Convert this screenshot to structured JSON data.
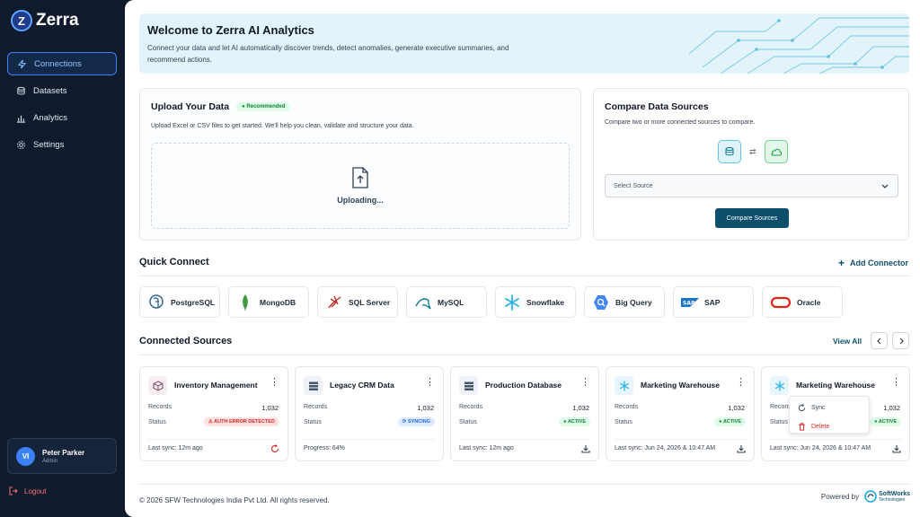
{
  "app": {
    "name": "Zerra",
    "logo_letter": "Z"
  },
  "sidebar": {
    "items": [
      {
        "label": "Connections",
        "icon": "bolt-icon",
        "active": true
      },
      {
        "label": "Datasets",
        "icon": "database-icon"
      },
      {
        "label": "Analytics",
        "icon": "chart-icon"
      },
      {
        "label": "Settings",
        "icon": "gear-icon"
      }
    ],
    "user": {
      "initials": "VI",
      "name": "Peter Parker",
      "role": "Admin"
    },
    "logout": "Logout"
  },
  "banner": {
    "title": "Welcome to Zerra AI Analytics",
    "text": "Connect your data and let AI automatically discover trends, detect anomalies, generate executive summaries, and recommend actions."
  },
  "upload": {
    "title": "Upload Your Data",
    "badge": "Recommended",
    "subtitle": "Upload Excel or CSV files to get started. We'll help you clean, validate and structure your data.",
    "status": "Uploading..."
  },
  "compare": {
    "title": "Compare Data Sources",
    "subtitle": "Compare two or more connected sources to compare.",
    "swap": "⇄",
    "select_placeholder": "Select Source",
    "button": "Compare Sources"
  },
  "quick_connect": {
    "title": "Quick Connect",
    "add": "Add Connector",
    "items": [
      {
        "label": "PostgreSQL",
        "icon": "postgresql-icon"
      },
      {
        "label": "MongoDB",
        "icon": "mongodb-icon"
      },
      {
        "label": "SQL Server",
        "icon": "sqlserver-icon"
      },
      {
        "label": "MySQL",
        "icon": "mysql-icon"
      },
      {
        "label": "Snowflake",
        "icon": "snowflake-icon"
      },
      {
        "label": "Big Query",
        "icon": "bigquery-icon"
      },
      {
        "label": "SAP",
        "icon": "sap-icon"
      },
      {
        "label": "Oracle",
        "icon": "oracle-icon"
      }
    ]
  },
  "connected": {
    "title": "Connected Sources",
    "view_all": "View All",
    "records_label": "Records",
    "status_label": "Status",
    "sources": [
      {
        "name": "Inventory Management",
        "records": "1,032",
        "status": "AUTH ERROR DETECTED",
        "status_type": "error",
        "footer": "Last sync: 12m ago",
        "icon": "cube-icon"
      },
      {
        "name": "Legacy CRM Data",
        "records": "1,032",
        "status": "SYNCING",
        "status_type": "syncing",
        "footer": "Progress: 64%",
        "progress": 0.64,
        "icon": "stack-icon"
      },
      {
        "name": "Production Database",
        "records": "1,032",
        "status": "ACTIVE",
        "status_type": "active",
        "footer": "Last sync: 12m ago",
        "icon": "stack-icon"
      },
      {
        "name": "Marketing Warehouse",
        "records": "1,032",
        "status": "ACTIVE",
        "status_type": "active",
        "footer": "Last sync: Jun 24, 2026 & 10:47 AM",
        "icon": "snowflake-icon"
      },
      {
        "name": "Marketing Warehouse",
        "records": "1,032",
        "status": "ACTIVE",
        "status_type": "active",
        "footer": "Last sync: Jun 24, 2026 & 10:47 AM",
        "icon": "snowflake-icon"
      }
    ],
    "menu": {
      "sync": "Sync",
      "delete": "Delete"
    }
  },
  "footer": {
    "copyright": "© 2026 SFW Technologies India Pvt Ltd. All rights reserved.",
    "powered": "Powered by",
    "brand": "SoftWorks",
    "brand_sub": "Technologies"
  }
}
